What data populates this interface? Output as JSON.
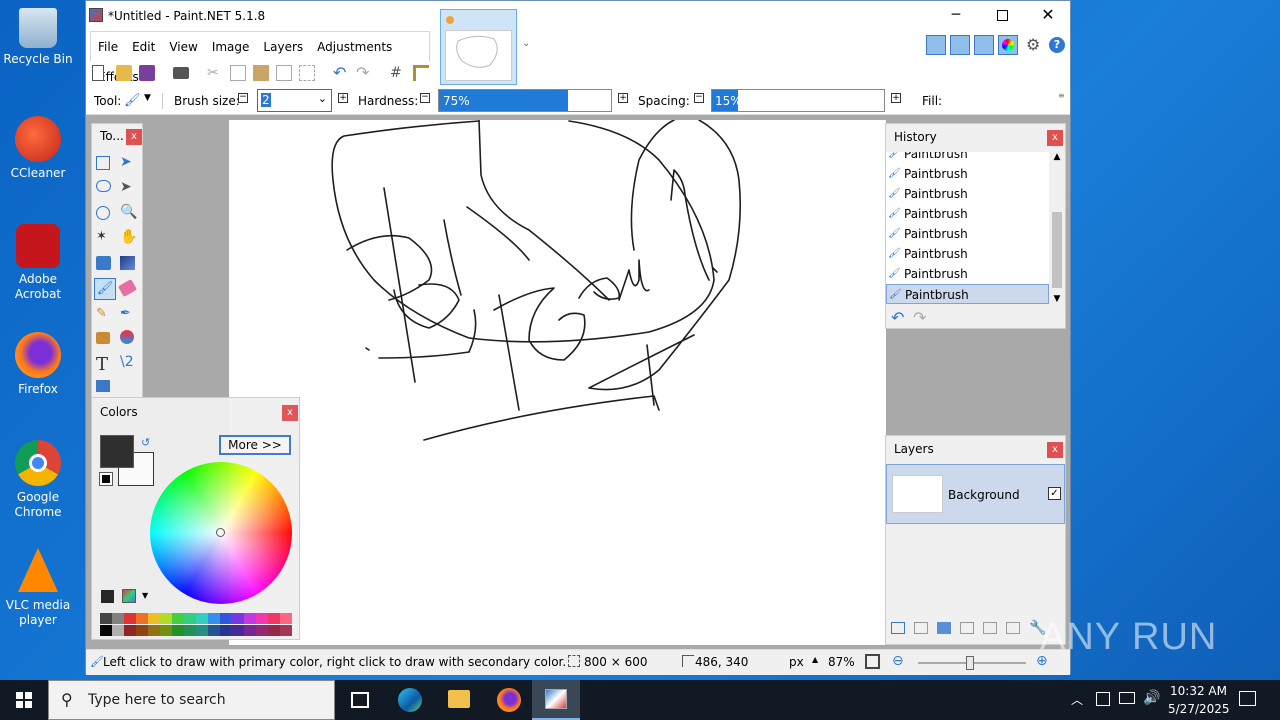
{
  "desktop": {
    "icons": [
      {
        "label": "Recycle Bin"
      },
      {
        "label": "CCleaner"
      },
      {
        "label": "Adobe Acrobat"
      },
      {
        "label": "Firefox"
      },
      {
        "label": "Google Chrome"
      },
      {
        "label": "VLC media player"
      }
    ]
  },
  "app": {
    "title": "*Untitled - Paint.NET 5.1.8",
    "menu": [
      "File",
      "Edit",
      "View",
      "Image",
      "Layers",
      "Adjustments",
      "Effects"
    ],
    "toolbar": {
      "tool_label": "Tool:",
      "brush_size_label": "Brush size:",
      "brush_size_value": "2",
      "hardness_label": "Hardness:",
      "hardness_value": "75%",
      "hardness_fraction": 0.75,
      "spacing_label": "Spacing:",
      "spacing_value": "15%",
      "spacing_fraction": 0.15,
      "fill_label": "Fill:"
    }
  },
  "tools_panel": {
    "title": "To..."
  },
  "history": {
    "title": "History",
    "items": [
      "Paintbrush",
      "Paintbrush",
      "Paintbrush",
      "Paintbrush",
      "Paintbrush",
      "Paintbrush",
      "Paintbrush",
      "Paintbrush"
    ],
    "selected_index": 7
  },
  "layers": {
    "title": "Layers",
    "items": [
      {
        "name": "Background",
        "visible": true
      }
    ]
  },
  "colors": {
    "title": "Colors",
    "more_button": "More >>",
    "primary": "#2b2b2b",
    "secondary": "#ffffff"
  },
  "status": {
    "hint": "Left click to draw with primary color, right click to draw with secondary color.",
    "image_size": "800 × 600",
    "cursor_pos": "486, 340",
    "unit": "px",
    "zoom": "87%"
  },
  "taskbar": {
    "search_placeholder": "Type here to search",
    "time": "10:32 AM",
    "date": "5/27/2025"
  },
  "watermark": "ANY RUN"
}
